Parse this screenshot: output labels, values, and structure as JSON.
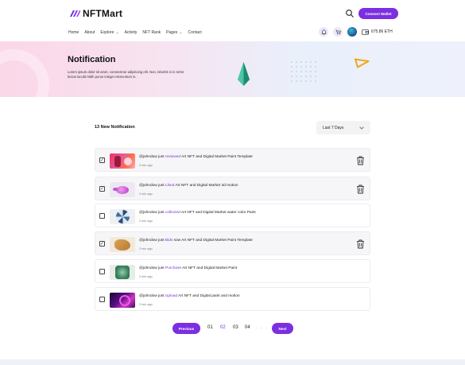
{
  "brand": {
    "name": "NFTMart",
    "accent": "#7b2fe0"
  },
  "header": {
    "connect_label": "Connect Wallet"
  },
  "nav": {
    "links": [
      {
        "label": "Home",
        "dropdown": false
      },
      {
        "label": "About",
        "dropdown": false
      },
      {
        "label": "Explore",
        "dropdown": true
      },
      {
        "label": "Activity",
        "dropdown": false
      },
      {
        "label": "NFT Rank",
        "dropdown": false
      },
      {
        "label": "Pages",
        "dropdown": true
      },
      {
        "label": "Contact",
        "dropdown": false
      }
    ],
    "wallet_balance": "675.86 ETH"
  },
  "hero": {
    "title": "Notification",
    "subtitle": "Lorem ipsum dolor sit amet, consectetur adipiscing elit. Non, lobortis in in tortor lectus iaculis Nibh purus integer elementum in."
  },
  "content": {
    "count_title": "13 New Notification",
    "filter": {
      "selected": "Last 7 Days"
    }
  },
  "notifications": [
    {
      "user": "@johndow just",
      "action": "reviewed",
      "rest": "Art NFT and Digital Market Paint Template",
      "time": "2 min ago",
      "checked": true
    },
    {
      "user": "@johndow just",
      "action": "Liked",
      "rest": "Art NFT and Digital Market 3d motion",
      "time": "2 min ago",
      "checked": true
    },
    {
      "user": "@johndow just",
      "action": "collected",
      "rest": "Art NFT and Digital Market water color Paint",
      "time": "2 min ago",
      "checked": false
    },
    {
      "user": "@johndow just",
      "action": "Bids",
      "rest": "sow Art NFT and Digital Market Paint Template",
      "time": "2 min ago",
      "checked": true
    },
    {
      "user": "@johndow just",
      "action": "Purchase",
      "rest": "Art NFT and Digital Market Paint",
      "time": "2 min ago",
      "checked": false
    },
    {
      "user": "@johndow just",
      "action": "Upload",
      "rest": "Art NFT and Digital paint and motion",
      "time": "2 min ago",
      "checked": false
    }
  ],
  "pagination": {
    "prev_label": "Previous",
    "next_label": "Next",
    "pages": [
      "01",
      "02",
      "03",
      "04"
    ],
    "current": "02",
    "ellipsis": ". . ."
  },
  "icons": {
    "search": "search-icon",
    "bell": "bell-icon",
    "cart": "cart-icon",
    "wallet": "wallet-icon",
    "trash": "trash-icon",
    "chevron": "chevron-down-icon"
  }
}
